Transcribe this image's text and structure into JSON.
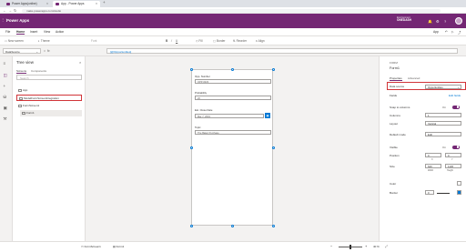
{
  "browser": {
    "tabs": [
      {
        "title": "Power Apps(online)"
      },
      {
        "title": "App - Power Apps"
      }
    ],
    "url": "make.powerapps.com/studio"
  },
  "app": {
    "brand": "Power Apps",
    "environment_label": "Environment",
    "environment_name": "ONEDASH",
    "colors": {
      "brand": "#742774",
      "accent": "#0078d4",
      "highlight": "#d13438"
    }
  },
  "menu": {
    "items": [
      "File",
      "Home",
      "Insert",
      "View",
      "Action"
    ],
    "active": "Home",
    "right_label": "App"
  },
  "toolbar": {
    "new_screen": "New screen",
    "theme": "Theme",
    "font_btn": "Font",
    "bold": "B",
    "italic": "/",
    "underline": "U",
    "fill": "Fill",
    "border": "Border",
    "reorder": "Reorder",
    "align": "Align"
  },
  "formula_bar": {
    "property": "DataSource",
    "equals": "=",
    "fx": "fx",
    "value": "[@Opportunities]"
  },
  "tree_view": {
    "title": "Tree view",
    "tabs": [
      "Screens",
      "Components"
    ],
    "active_tab": "Screens",
    "search_placeholder": "Search",
    "items": [
      {
        "label": "App",
        "highlighted": false
      },
      {
        "label": "ModelFormScreenIntegration",
        "highlighted": true
      },
      {
        "label": "FormScreen1",
        "highlighted": false
      },
      {
        "label": "Form1",
        "highlighted": false,
        "sub": true
      }
    ]
  },
  "form": {
    "fields": [
      {
        "label": "Opp. Number",
        "value": "OPP-0023"
      },
      {
        "label": "Probability",
        "value": "20"
      },
      {
        "label": "Est. Close Date",
        "value": "Mar 7, 2019",
        "date": true
      },
      {
        "label": "Topic",
        "value": "The Baker Purchase"
      }
    ]
  },
  "properties": {
    "control_type": "FORM",
    "control_name": "Form1",
    "tabs": [
      "Properties",
      "Advanced"
    ],
    "active_tab": "Properties",
    "data_source_label": "Data source",
    "data_source_value": "Opportunities",
    "fields_label": "Fields",
    "edit_fields": "Edit fields",
    "snap_label": "Snap to columns",
    "snap_value": "On",
    "columns_label": "Columns",
    "columns_value": "1",
    "layout_label": "Layout",
    "layout_value": "Vertical",
    "mode_label": "Default mode",
    "mode_value": "Edit",
    "visible_label": "Visible",
    "visible_value": "On",
    "position_label": "Position",
    "position_x": "0",
    "position_y": "0",
    "x_label": "X",
    "y_label": "Y",
    "size_label": "Size",
    "size_w": "640",
    "size_h": "1136",
    "width_label": "Width",
    "height_label": "Height",
    "color_label": "Color",
    "border_label": "Border",
    "border_width": "0"
  },
  "status": {
    "screen_tab": "FormScreen1",
    "form_tab": "Form1",
    "zoom": "40 %"
  }
}
